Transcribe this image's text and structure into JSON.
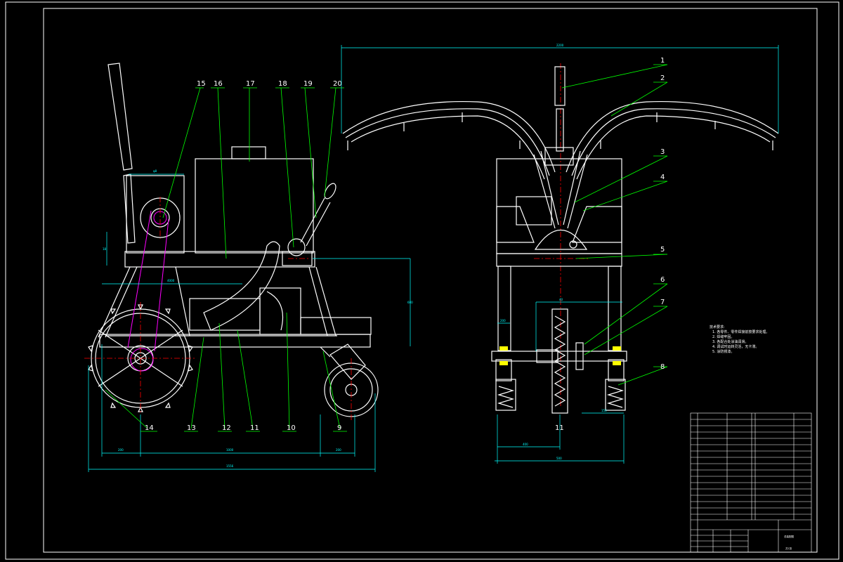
{
  "colors": {
    "background": "#000000",
    "outline": "#ffffff",
    "dimension": "#00ffff",
    "leader": "#00ff00",
    "centerline": "#ff0000",
    "chain": "#ff00ff",
    "bearing": "#ffff00"
  },
  "part_labels": {
    "p1": "1",
    "p2": "2",
    "p3": "3",
    "p4": "4",
    "p5": "5",
    "p6": "6",
    "p7": "7",
    "p8": "8",
    "p9": "9",
    "p10": "10",
    "p11a": "11",
    "p11b": "11",
    "p12": "12",
    "p13": "13",
    "p14": "14",
    "p15": "15",
    "p16": "16",
    "p17": "17",
    "p18": "18",
    "p19": "19",
    "p20": "20"
  },
  "dimensions": {
    "d_span": "2200",
    "d_top_left": "φ8",
    "d_left_small": "18",
    "d_left_width": "4000",
    "d_height": "600",
    "d_b1": "200",
    "d_b2": "1000",
    "d_b3": "200",
    "d_total": "1556",
    "d_rear_w": "200",
    "d_rear_h": "40",
    "d_r1": "400",
    "d_r2": "500",
    "d_r3": "150",
    "d_r4": "800"
  },
  "notes": {
    "title": "技术要求:",
    "line1": "1. 各零件、零件焊接前按要求处理。",
    "line2": "2. 焊缝牢固。",
    "line3": "3. 各配合处涂油润滑。",
    "line4": "4. 调试时运转灵活，无卡滞。",
    "line5": "5. 涂防锈漆。"
  },
  "title_block": {
    "drawing_name": "总装配图",
    "sheet": "共1张"
  }
}
